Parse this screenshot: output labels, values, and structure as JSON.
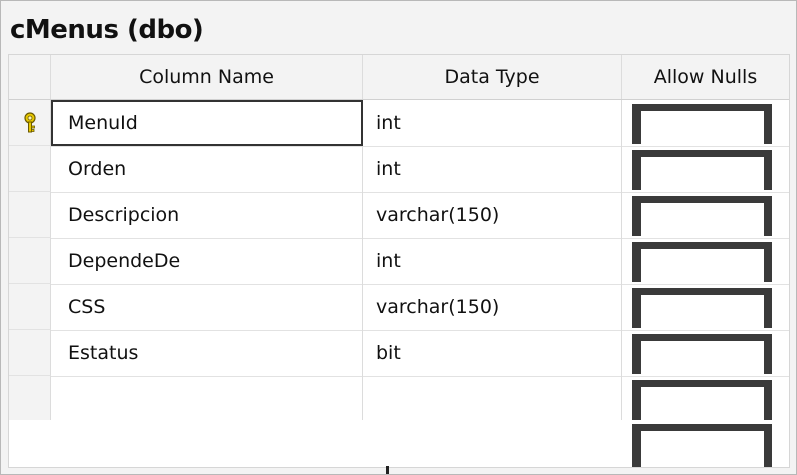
{
  "table": {
    "title": "cMenus (dbo)"
  },
  "headers": {
    "column_name": "Column Name",
    "data_type": "Data Type",
    "allow_nulls": "Allow Nulls"
  },
  "rows": [
    {
      "name": "MenuId",
      "type": "int",
      "allow_nulls": false,
      "primary_key": true
    },
    {
      "name": "Orden",
      "type": "int",
      "allow_nulls": false
    },
    {
      "name": "Descripcion",
      "type": "varchar(150)",
      "allow_nulls": false
    },
    {
      "name": "DependeDe",
      "type": "int",
      "allow_nulls": false
    },
    {
      "name": "CSS",
      "type": "varchar(150)",
      "allow_nulls": false
    },
    {
      "name": "Estatus",
      "type": "bit",
      "allow_nulls": false
    },
    {
      "name": "",
      "type": "",
      "allow_nulls": false
    }
  ],
  "icons": {
    "primary_key": "key-icon"
  },
  "colors": {
    "key": "#d8b800",
    "checkbox_border": "#3a3a3a"
  }
}
